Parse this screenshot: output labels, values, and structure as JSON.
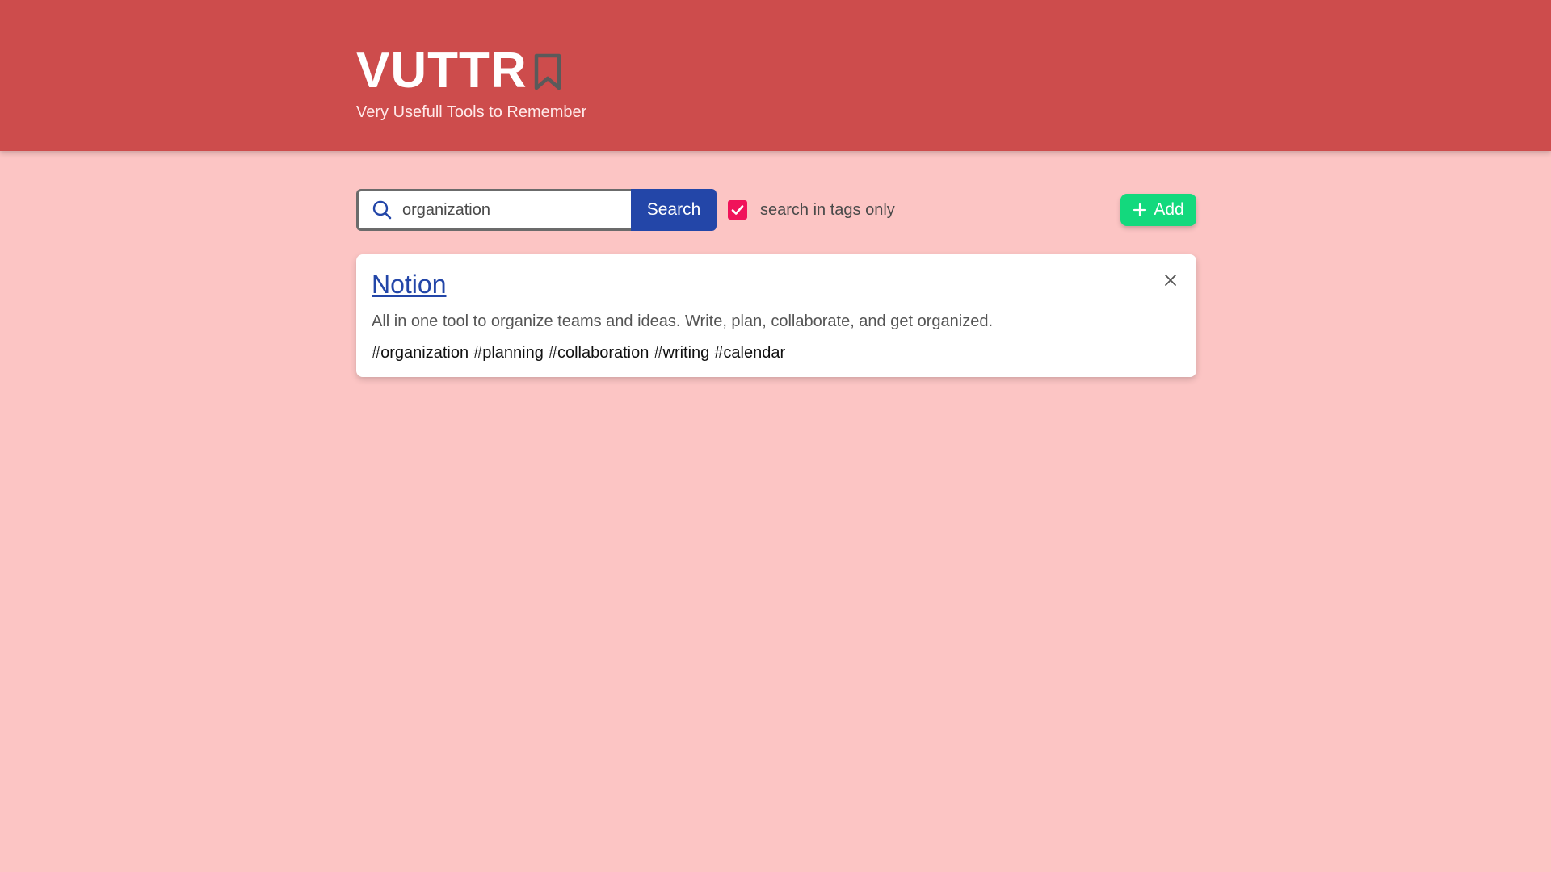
{
  "header": {
    "title": "VUTTR",
    "subtitle": "Very Usefull Tools to Remember",
    "icon": "bookmark-icon",
    "background_color": "#cd4c4c"
  },
  "search": {
    "icon": "search-icon",
    "value": "organization",
    "placeholder": "",
    "button_label": "Search",
    "tags_only_checked": true,
    "tags_only_label": "search in tags only"
  },
  "add_button": {
    "icon": "plus-icon",
    "label": "Add",
    "color": "#13d97d"
  },
  "tools": [
    {
      "title": "Notion",
      "description": "All in one tool to organize teams and ideas. Write, plan, collaborate, and get organized.",
      "tags": [
        "#organization",
        "#planning",
        "#collaboration",
        "#writing",
        "#calendar"
      ],
      "remove_icon": "close-icon"
    }
  ],
  "colors": {
    "page_background": "#fcc5c4",
    "primary_button": "#2346a8",
    "checkbox": "#f0135a"
  }
}
